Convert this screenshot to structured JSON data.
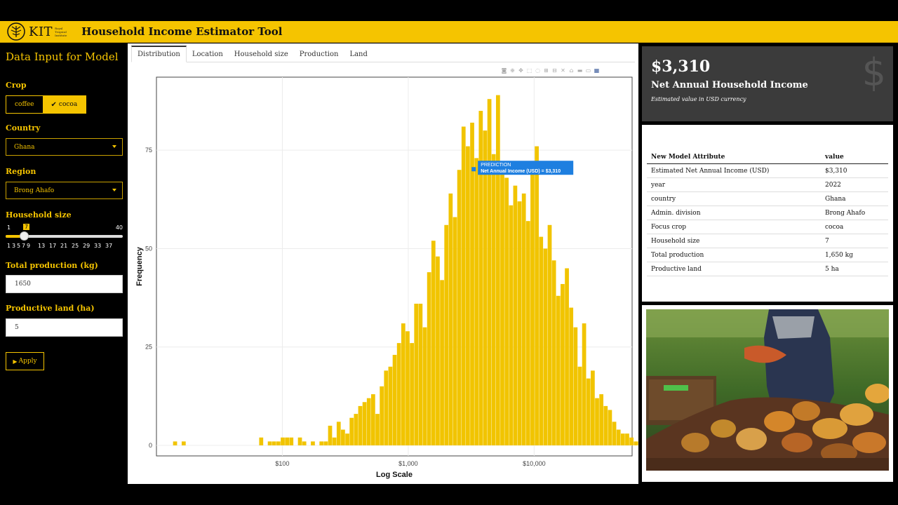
{
  "header": {
    "logo_text": "KIT",
    "logo_sub": "Royal Tropical Institute",
    "title": "Household Income Estimator Tool"
  },
  "sidebar": {
    "title": "Data Input for Model",
    "crop": {
      "label": "Crop",
      "options": [
        "coffee",
        "cocoa"
      ],
      "selected": "cocoa"
    },
    "country": {
      "label": "Country",
      "value": "Ghana"
    },
    "region": {
      "label": "Region",
      "value": "Brong Ahafo"
    },
    "household": {
      "label": "Household size",
      "min": "1",
      "max": "40",
      "value": "7",
      "fraction": 0.154,
      "ticks": [
        "1",
        "3",
        "5",
        "7",
        "9",
        "13",
        "17",
        "21",
        "25",
        "29",
        "33",
        "37"
      ]
    },
    "production": {
      "label": "Total production (kg)",
      "value": "1650"
    },
    "land": {
      "label": "Productive land (ha)",
      "value": "5"
    },
    "apply_label": "Apply"
  },
  "tabs": [
    "Distribution",
    "Location",
    "Household size",
    "Production",
    "Land"
  ],
  "active_tab": "Distribution",
  "summary": {
    "amount": "$3,310",
    "title": "Net Annual Household Income",
    "note": "Estimated value in USD currency",
    "icon": "dollar-icon"
  },
  "attributes": {
    "headers": [
      "New Model Attribute",
      "value"
    ],
    "rows": [
      [
        "Estimated Net Annual Income (USD)",
        "$3,310"
      ],
      [
        "year",
        "2022"
      ],
      [
        "country",
        "Ghana"
      ],
      [
        "Admin. division",
        "Brong Ahafo"
      ],
      [
        "Focus crop",
        "cocoa"
      ],
      [
        "Household size",
        "7"
      ],
      [
        "Total production",
        "1,650 kg"
      ],
      [
        "Productive land",
        "5 ha"
      ]
    ]
  },
  "chart_data": {
    "type": "bar",
    "xlabel": "Log Scale",
    "ylabel": "Frequency",
    "x_scale": "log",
    "xlim": [
      10,
      60000
    ],
    "ylim": [
      0,
      90
    ],
    "x_ticks": [
      100,
      1000,
      10000
    ],
    "x_tick_labels": [
      "$100",
      "$1,000",
      "$10,000"
    ],
    "y_ticks": [
      0,
      25,
      50,
      75
    ],
    "bar_color": "#f1c400",
    "bin_log_start": 1.132,
    "bin_log_width": 0.0342,
    "values": [
      1,
      0,
      1,
      0,
      0,
      0,
      0,
      0,
      0,
      0,
      0,
      0,
      0,
      0,
      0,
      0,
      0,
      0,
      0,
      0,
      2,
      0,
      1,
      1,
      1,
      2,
      2,
      2,
      0,
      2,
      1,
      0,
      1,
      0,
      1,
      1,
      5,
      2,
      6,
      4,
      3,
      7,
      8,
      10,
      11,
      12,
      13,
      8,
      15,
      19,
      20,
      23,
      26,
      31,
      29,
      26,
      36,
      36,
      30,
      44,
      52,
      48,
      42,
      56,
      64,
      58,
      70,
      81,
      76,
      82,
      73,
      85,
      80,
      88,
      74,
      89,
      72,
      68,
      61,
      66,
      62,
      64,
      57,
      70,
      76,
      53,
      50,
      56,
      47,
      38,
      41,
      45,
      35,
      30,
      20,
      31,
      17,
      19,
      12,
      13,
      10,
      9,
      6,
      4,
      3,
      3,
      2,
      1,
      1,
      2,
      0,
      1,
      0,
      2,
      1,
      1,
      1,
      1,
      0,
      0,
      1
    ],
    "annotation": {
      "title": "PREDICTION",
      "text": "Net Annual Income (USD) = $3,310",
      "x": 3310,
      "y": 70
    }
  }
}
